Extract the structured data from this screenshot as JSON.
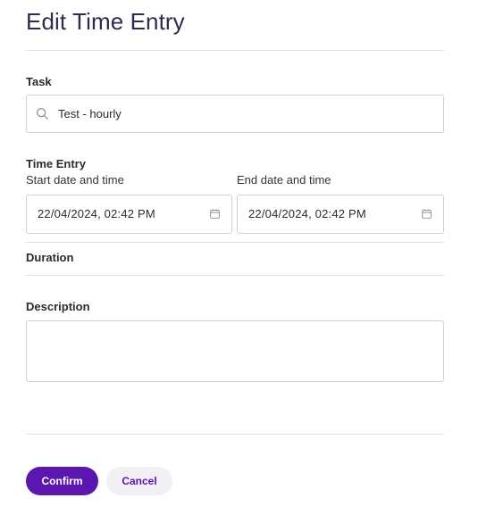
{
  "page": {
    "title": "Edit Time Entry"
  },
  "task": {
    "label": "Task",
    "value": "Test - hourly",
    "icon": "search-icon"
  },
  "time_entry": {
    "label": "Time Entry",
    "start": {
      "label": "Start date and time",
      "value": "22/04/2024, 02:42 PM",
      "icon": "calendar-icon"
    },
    "end": {
      "label": "End date and time",
      "value": "22/04/2024, 02:42 PM",
      "icon": "calendar-icon"
    }
  },
  "duration": {
    "label": "Duration"
  },
  "description": {
    "label": "Description",
    "value": ""
  },
  "actions": {
    "confirm_label": "Confirm",
    "cancel_label": "Cancel"
  },
  "colors": {
    "accent": "#5b16b0",
    "title": "#2f2a4f",
    "border": "#cfcfd6",
    "cancel_bg": "#f2f0f4"
  }
}
